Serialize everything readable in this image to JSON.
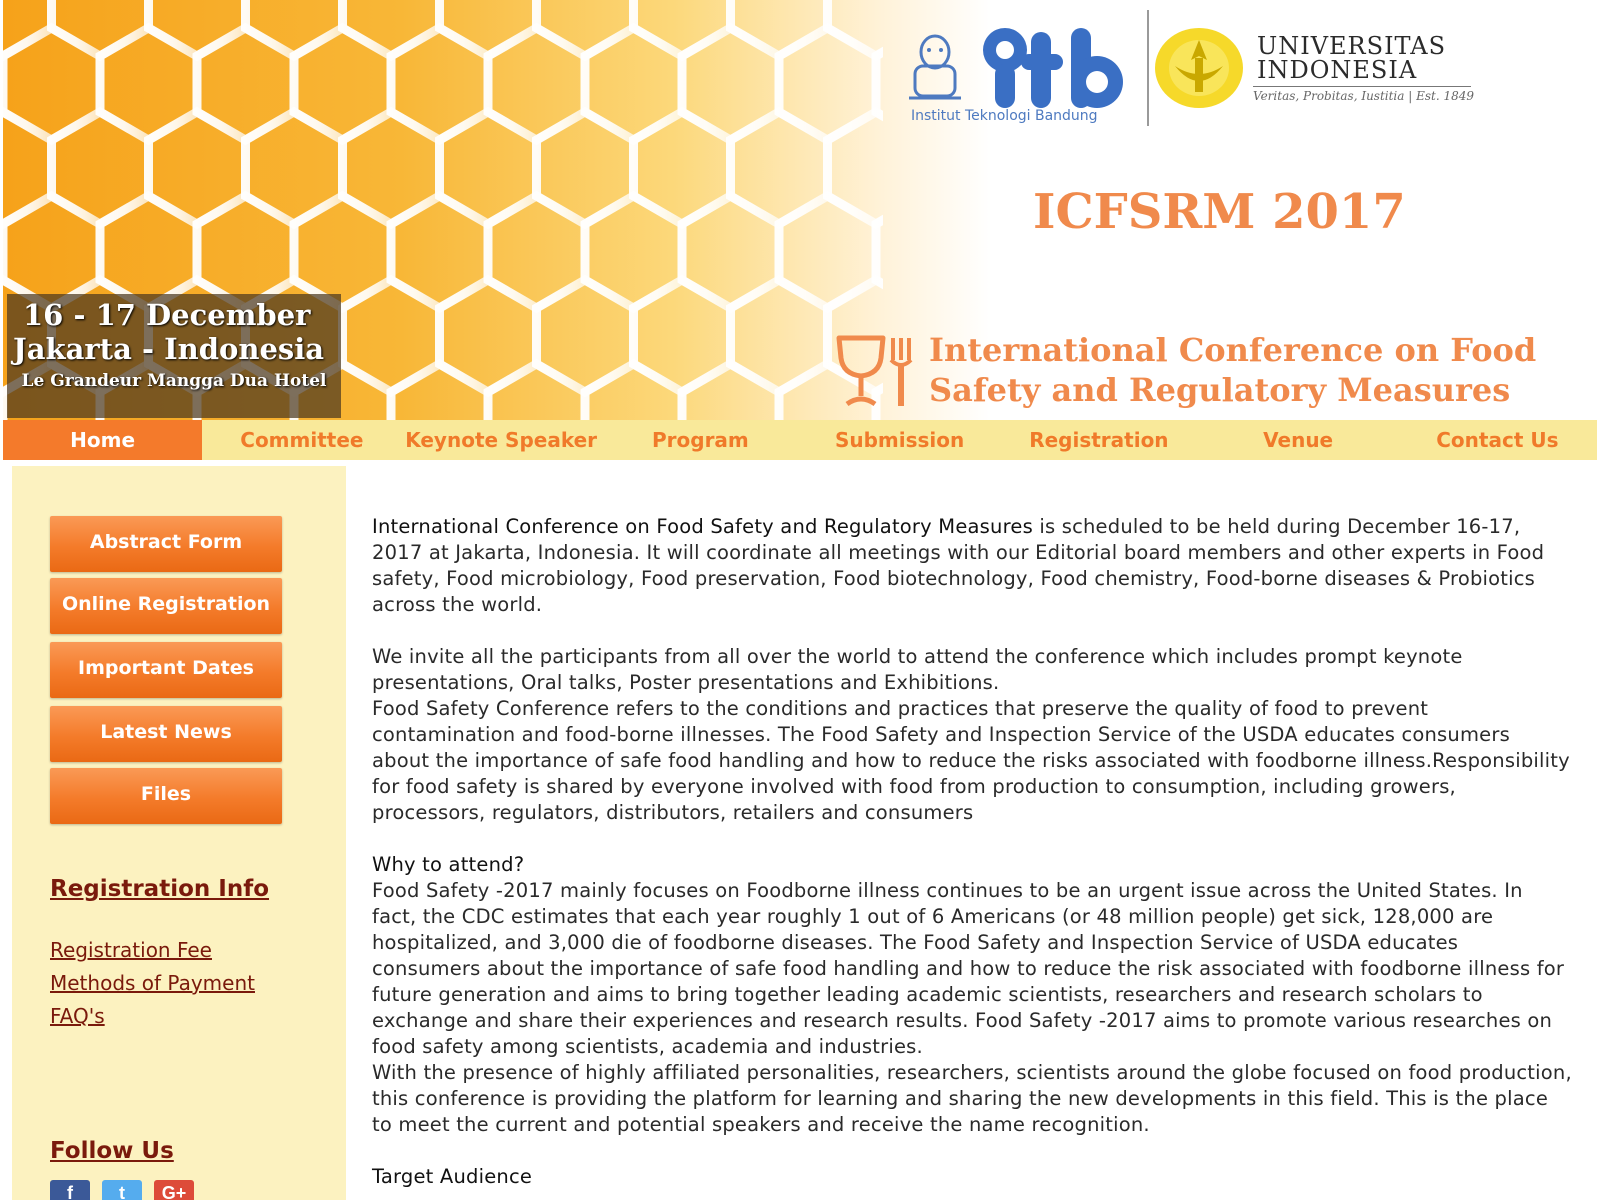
{
  "banner": {
    "date_line1": "16 - 17  December",
    "date_line2": "Jakarta - Indonesia",
    "venue_line": "Le Grandeur Mangga Dua Hotel",
    "itb_name": "Institut Teknologi Bandung",
    "itb_mark_text": "itb",
    "ui_name_line1": "UNIVERSITAS",
    "ui_name_line2": "INDONESIA",
    "ui_motto": "Veritas, Probitas, Iustitia | Est. 1849",
    "conference_acronym": "ICFSRM 2017",
    "conference_title_line1": "International Conference on Food",
    "conference_title_line2": "Safety and Regulatory Measures"
  },
  "nav": {
    "items": [
      {
        "label": "Home"
      },
      {
        "label": "Committee"
      },
      {
        "label": "Keynote Speaker"
      },
      {
        "label": "Program"
      },
      {
        "label": "Submission"
      },
      {
        "label": "Registration"
      },
      {
        "label": "Venue"
      },
      {
        "label": "Contact Us"
      }
    ],
    "active": "Home"
  },
  "sidebar": {
    "buttons": [
      {
        "label": "Abstract Form"
      },
      {
        "label": "Online Registration"
      },
      {
        "label": "Important Dates"
      },
      {
        "label": "Latest News"
      },
      {
        "label": "Files"
      }
    ],
    "registration_heading": "Registration Info",
    "registration_links": [
      {
        "label": "Registration Fee"
      },
      {
        "label": "Methods of Payment"
      },
      {
        "label": "FAQ's"
      }
    ],
    "follow_heading": "Follow Us",
    "social": [
      {
        "glyph": "f",
        "color": "#3b5998"
      },
      {
        "glyph": "t",
        "color": "#55acee"
      },
      {
        "glyph": "G+",
        "color": "#dd4b39"
      }
    ]
  },
  "main": {
    "intro_lead": "International Conference on Food Safety and Regulatory Measures",
    "intro_rest": " is scheduled to be held during December 16-17, 2017 at Jakarta, Indonesia. It will coordinate all meetings with our Editorial board members and other experts in Food safety, Food microbiology, Food preservation, Food biotechnology, Food chemistry, Food-borne diseases & Probiotics across the world.",
    "para2": "We  invite all the participants from all over the world to attend the conference which includes prompt keynote presentations, Oral talks, Poster presentations and Exhibitions.",
    "para3": "Food Safety Conference refers to the conditions and practices that preserve the quality of food to prevent contamination and food-borne illnesses. The Food Safety and Inspection Service of the USDA educates consumers about the importance of safe food handling and how to reduce the risks associated with foodborne illness.Responsibility for food safety is shared by everyone involved with food from production to consumption, including growers, processors, regulators, distributors, retailers and consumers",
    "why_heading": "Why to attend?",
    "why_para": "Food Safety -2017 mainly focuses on Foodborne illness continues to be an urgent issue across the United States. In fact, the CDC estimates that each year roughly 1 out of 6 Americans (or 48 million people) get sick, 128,000 are hospitalized, and 3,000 die of foodborne diseases.   The Food Safety and Inspection Service of USDA educates consumers about the importance of safe food handling and how to reduce the risk associated with foodborne illness for future generation and aims to bring together leading academic scientists, researchers and research scholars to exchange and share their experiences and research results. Food Safety -2017 aims to promote various researches on food safety among scientists, academia and industries.",
    "why_para2": "With the presence of highly affiliated personalities, researchers, scientists around the globe focused on food production, this conference is providing the platform for learning and sharing the new developments in this field.  This is the place to meet the current and potential speakers and receive the name recognition.",
    "target_heading": "Target Audience"
  },
  "colors": {
    "accent_orange": "#f47a2b",
    "nav_bg": "#f9e99a",
    "sidebar_bg": "#fcf2c0",
    "link_maroon": "#7a1a0c",
    "title_orange": "#f08a4c"
  }
}
